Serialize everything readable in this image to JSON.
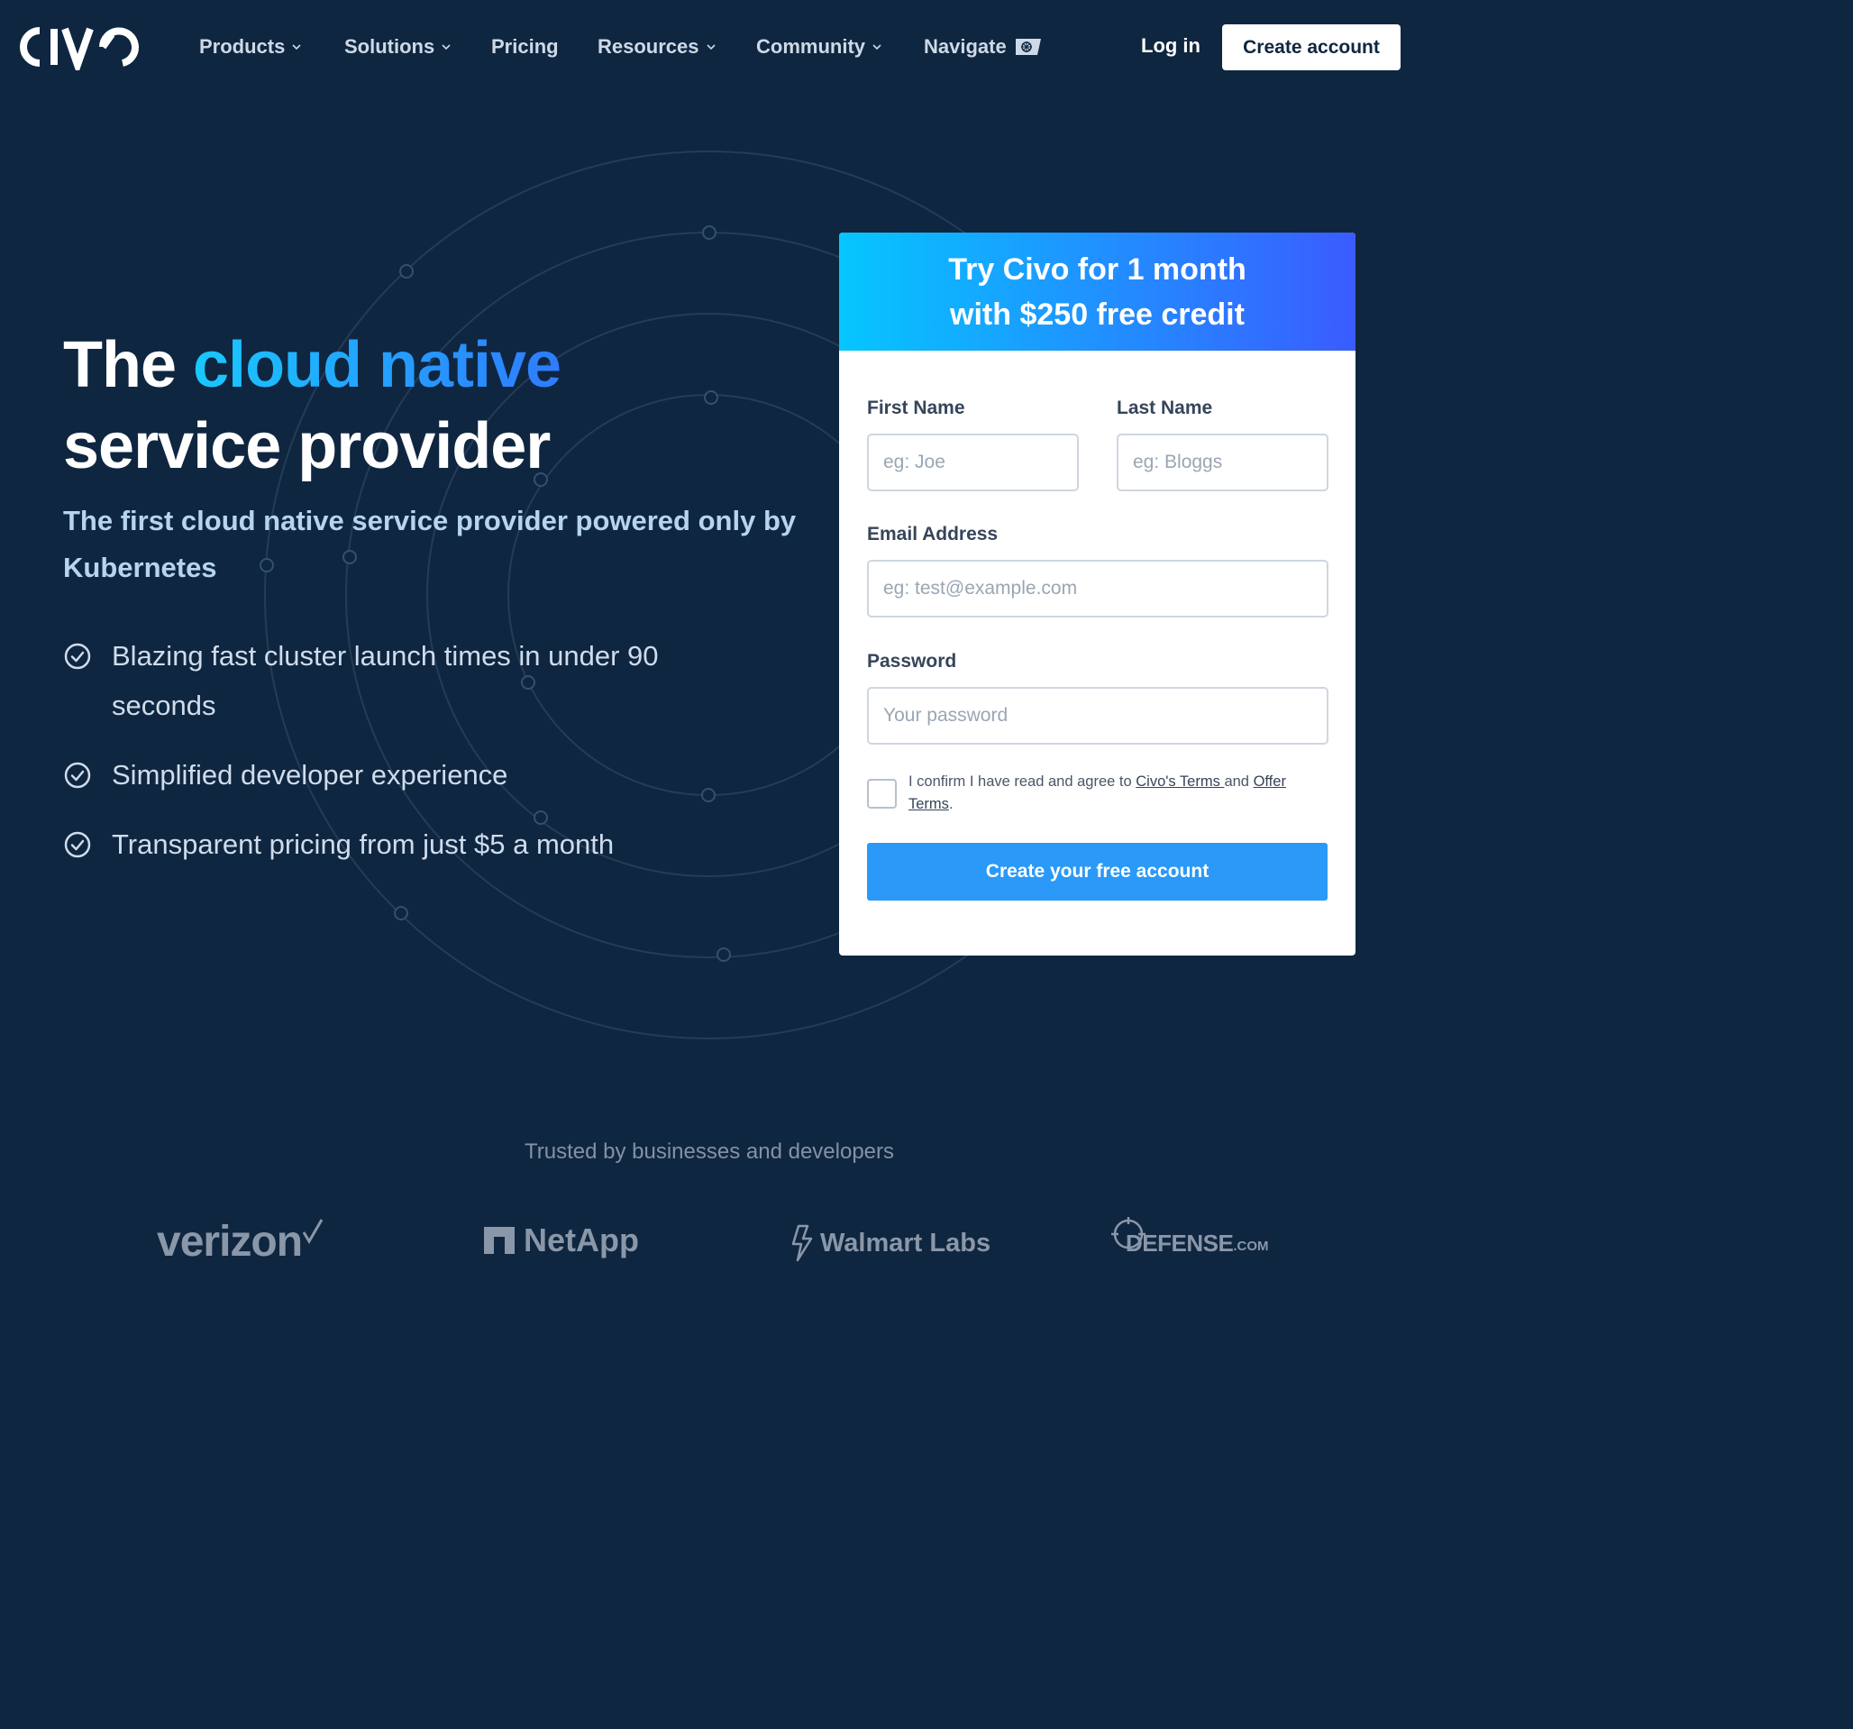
{
  "nav": {
    "brand": "CIVO",
    "items": [
      {
        "label": "Products",
        "dropdown": true
      },
      {
        "label": "Solutions",
        "dropdown": true
      },
      {
        "label": "Pricing",
        "dropdown": false
      },
      {
        "label": "Resources",
        "dropdown": true
      },
      {
        "label": "Community",
        "dropdown": true
      },
      {
        "label": "Navigate",
        "dropdown": false
      }
    ],
    "login": "Log in",
    "create_account": "Create account"
  },
  "hero": {
    "title_part1": "The ",
    "title_highlight": "cloud native",
    "title_part2": "service provider",
    "subtitle": "The first cloud native service provider powered only by Kubernetes",
    "bullets": [
      "Blazing fast cluster launch times in under 90 seconds",
      "Simplified developer experience",
      "Transparent pricing from just $5 a month"
    ]
  },
  "signup": {
    "heading_line1": "Try Civo for 1 month",
    "heading_line2": "with $250 free credit",
    "first_name_label": "First Name",
    "first_name_placeholder": "eg: Joe",
    "last_name_label": "Last Name",
    "last_name_placeholder": "eg: Bloggs",
    "email_label": "Email Address",
    "email_placeholder": "eg: test@example.com",
    "password_label": "Password",
    "password_placeholder": "Your password",
    "terms_prefix": "I confirm I have read and agree to ",
    "terms_link1": "Civo's Terms ",
    "terms_mid": "and ",
    "terms_link2": "Offer Terms",
    "terms_suffix": ".",
    "submit": "Create your free account"
  },
  "trusted": {
    "heading": "Trusted by businesses and developers",
    "logos": [
      "verizon",
      "NetApp",
      "Walmart Labs",
      "DEFENSE",
      ".COM"
    ]
  },
  "colors": {
    "background": "#0f2640",
    "accent_cyan": "#19c8ff",
    "accent_blue": "#2f7bff",
    "submit_blue": "#2a99f8"
  }
}
